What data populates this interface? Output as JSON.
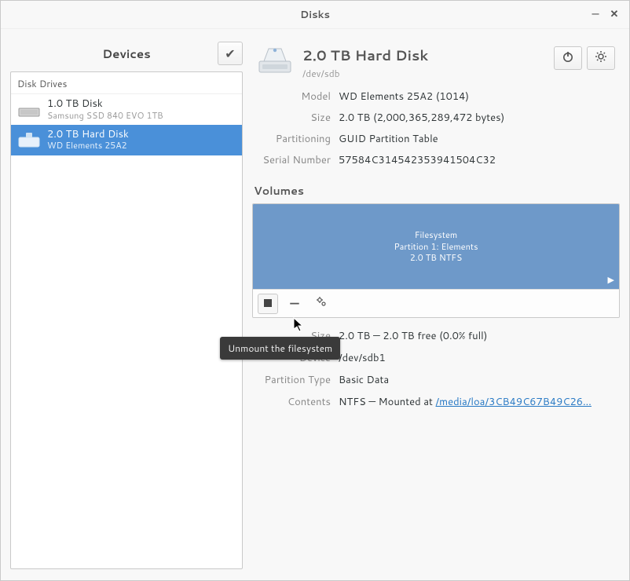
{
  "window": {
    "title": "Disks"
  },
  "left": {
    "header": "Devices",
    "section": "Disk Drives",
    "items": [
      {
        "title": "1.0 TB Disk",
        "sub": "Samsung SSD 840 EVO 1TB",
        "icon": "hdd-ssd-icon",
        "selected": false
      },
      {
        "title": "2.0 TB Hard Disk",
        "sub": "WD Elements 25A2",
        "icon": "hdd-ext-icon",
        "selected": true
      }
    ]
  },
  "disk": {
    "title": "2.0 TB Hard Disk",
    "device": "/dev/sdb",
    "props": {
      "model_label": "Model",
      "model": "WD Elements 25A2 (1014)",
      "size_label": "Size",
      "size": "2.0 TB (2,000,365,289,472 bytes)",
      "part_label": "Partitioning",
      "part": "GUID Partition Table",
      "serial_label": "Serial Number",
      "serial": "57584C314542353941504C32"
    }
  },
  "volumes": {
    "label": "Volumes",
    "block": {
      "line1": "Filesystem",
      "line2": "Partition 1: Elements",
      "line3": "2.0 TB NTFS"
    }
  },
  "tooltip": "Unmount the filesystem",
  "vol_details": {
    "size_label": "Size",
    "size": "2.0 TB — 2.0 TB free (0.0% full)",
    "dev_label": "Device",
    "dev": "/dev/sdb1",
    "ptype_label": "Partition Type",
    "ptype": "Basic Data",
    "contents_label": "Contents",
    "contents_prefix": "NTFS — Mounted at ",
    "mount_link": "/media/loa/3CB49C67B49C26…"
  }
}
